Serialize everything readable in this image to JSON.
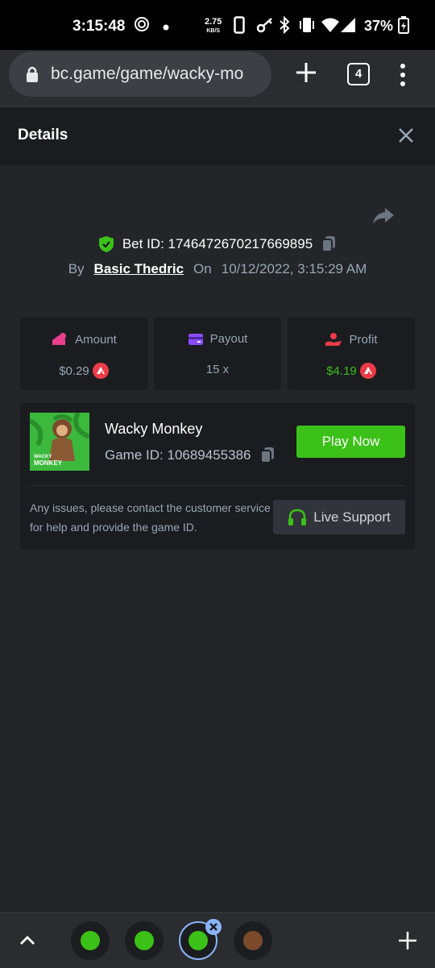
{
  "status": {
    "time": "3:15:48",
    "net_speed": "2.75",
    "net_unit": "KB/S",
    "battery": "37%"
  },
  "browser": {
    "url": "bc.game/game/wacky-mo",
    "tab_count": "4"
  },
  "details": {
    "title": "Details"
  },
  "bet": {
    "label": "Bet ID:",
    "id": "1746472670217669895",
    "by_label": "By",
    "user": "Basic Thedric",
    "on_label": "On",
    "date": "10/12/2022, 3:15:29 AM"
  },
  "stats": [
    {
      "label": "Amount",
      "value": "$0.29",
      "value_color": "#98a7b5"
    },
    {
      "label": "Payout",
      "value": "15 x",
      "value_color": "#98a7b5"
    },
    {
      "label": "Profit",
      "value": "$4.19",
      "value_color": "#3bc117"
    }
  ],
  "game": {
    "name": "Wacky Monkey",
    "id_label": "Game ID:",
    "id": "10689455386",
    "play_label": "Play Now",
    "thumb_text_1": "WACKY",
    "thumb_text_2": "MONKEY",
    "issue_text": "Any issues, please contact the customer service for help and provide the game ID.",
    "support_label": "Live Support"
  },
  "colors": {
    "accent_green": "#3bc117",
    "coin_red": "#ed3b48",
    "panel": "#1a1c1f",
    "background": "#232529"
  }
}
